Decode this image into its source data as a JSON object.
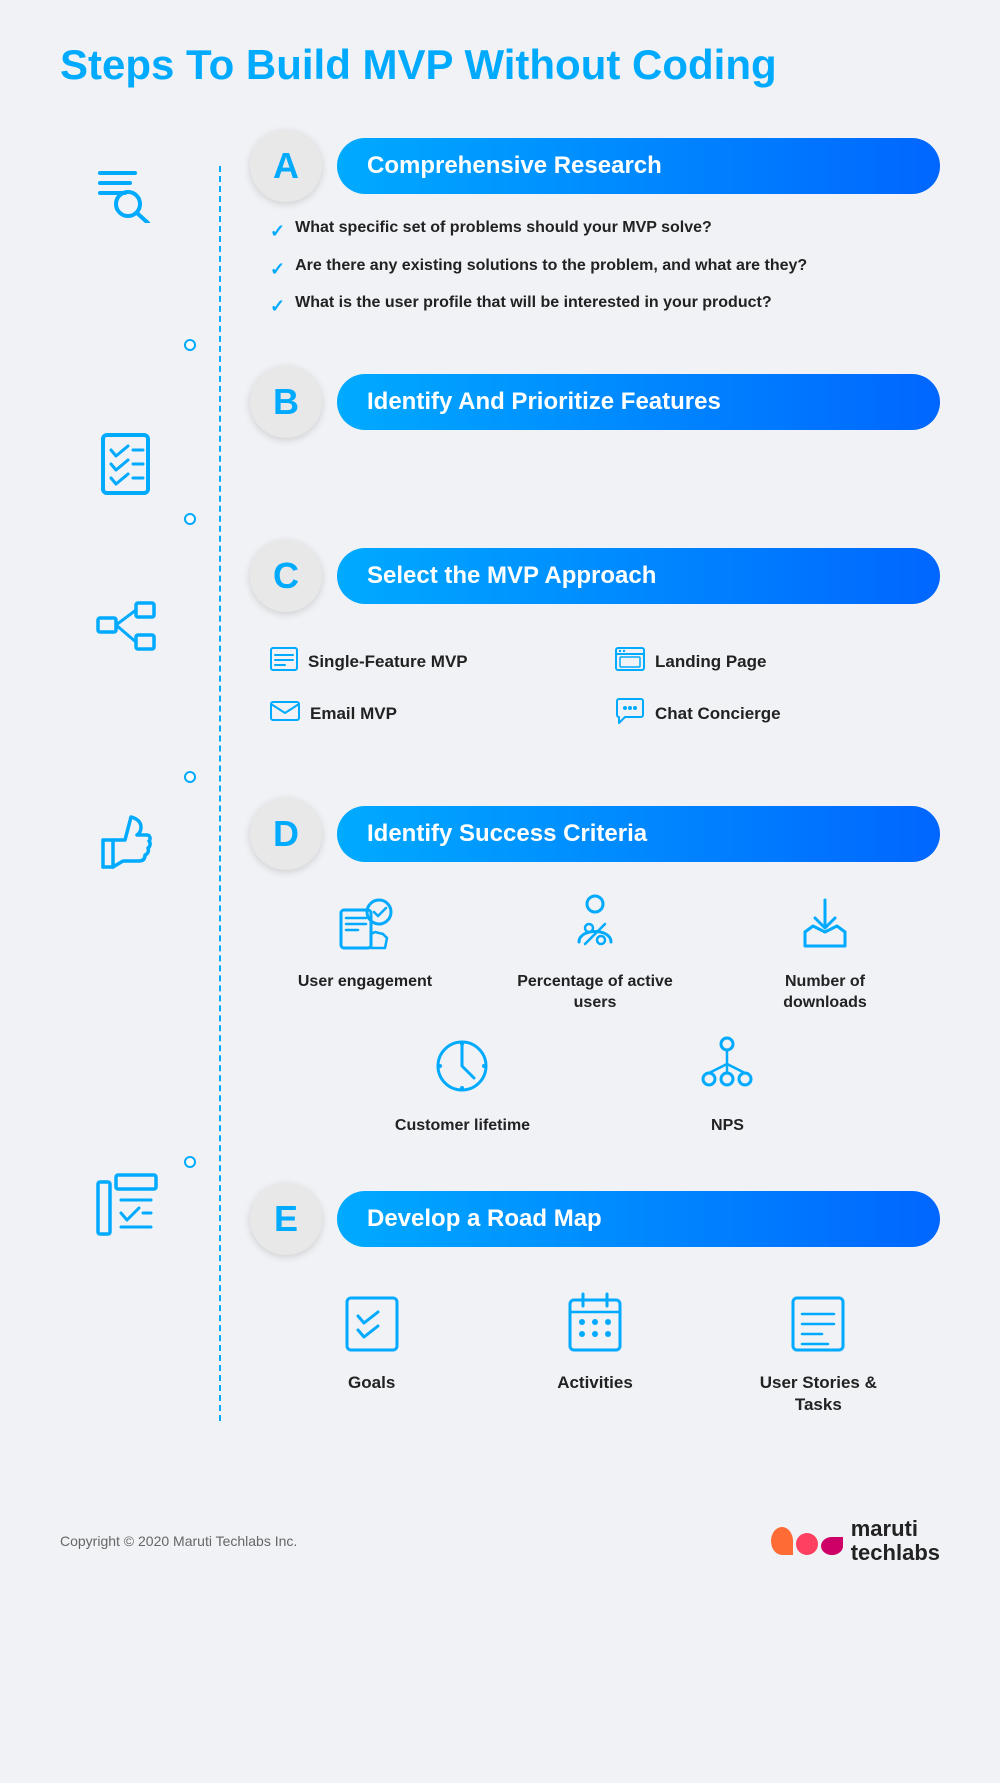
{
  "title": "Steps To Build MVP Without Coding",
  "steps": [
    {
      "letter": "A",
      "label": "Comprehensive Research",
      "icon": "search-list",
      "checklist": [
        "What specific set of problems should your MVP solve?",
        "Are there any existing solutions to the problem, and what are they?",
        "What is the user profile that will be interested in your product?"
      ]
    },
    {
      "letter": "B",
      "label": "Identify And Prioritize Features",
      "icon": "checklist-doc",
      "checklist": []
    },
    {
      "letter": "C",
      "label": "Select the MVP Approach",
      "icon": "hierarchy",
      "approaches": [
        {
          "icon": "list",
          "label": "Single-Feature MVP"
        },
        {
          "icon": "browser",
          "label": "Landing Page"
        },
        {
          "icon": "email",
          "label": "Email MVP"
        },
        {
          "icon": "chat",
          "label": "Chat Concierge"
        }
      ]
    },
    {
      "letter": "D",
      "label": "Identify Success Criteria",
      "icon": "thumbsup",
      "criteria": [
        {
          "icon": "tablet-hand",
          "label": "User engagement"
        },
        {
          "icon": "percent-person",
          "label": "Percentage of active users"
        },
        {
          "icon": "download-box",
          "label": "Number of downloads"
        },
        {
          "icon": "clock-circle",
          "label": "Customer lifetime"
        },
        {
          "icon": "nps-tree",
          "label": "NPS"
        }
      ]
    },
    {
      "letter": "E",
      "label": "Develop a Road Map",
      "icon": "checklist-bar",
      "roadmap": [
        {
          "icon": "goals-doc",
          "label": "Goals"
        },
        {
          "icon": "calendar-dots",
          "label": "Activities"
        },
        {
          "icon": "user-stories",
          "label": "User Stories & Tasks"
        }
      ]
    }
  ],
  "footer": {
    "copyright": "Copyright © 2020 Maruti Techlabs Inc.",
    "logo_line1": "maruti",
    "logo_line2": "techlabs"
  }
}
